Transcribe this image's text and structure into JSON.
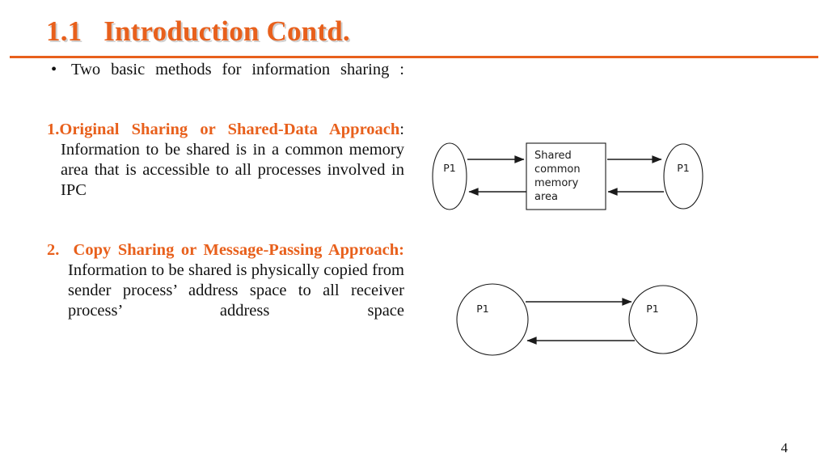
{
  "slide": {
    "title": "1.1   Introduction Contd.",
    "page_number": "4",
    "accent_color": "#E8601C",
    "text_color": "#111111"
  },
  "body": {
    "bullet_glyph": "•",
    "intro": "Two basic methods for information sharing :",
    "items": [
      {
        "number": "1.",
        "heading": "Original Sharing or Shared-Data Approach",
        "separator": ":",
        "text": " Information to be shared is in a common memory area that is accessible to all processes involved in IPC"
      },
      {
        "number": "2.",
        "heading": "Copy Sharing or Message-Passing Approach",
        "separator": ":",
        "text": " Information to be shared is physically copied from sender process’ address space to all receiver process’ address space"
      }
    ]
  },
  "diagrams": [
    {
      "id": "shared-memory",
      "left_process_label": "P1",
      "right_process_label": "P1",
      "memory_box_lines": [
        "Shared",
        "common",
        "memory",
        "area"
      ]
    },
    {
      "id": "message-passing",
      "left_process_label": "P1",
      "right_process_label": "P1"
    }
  ]
}
